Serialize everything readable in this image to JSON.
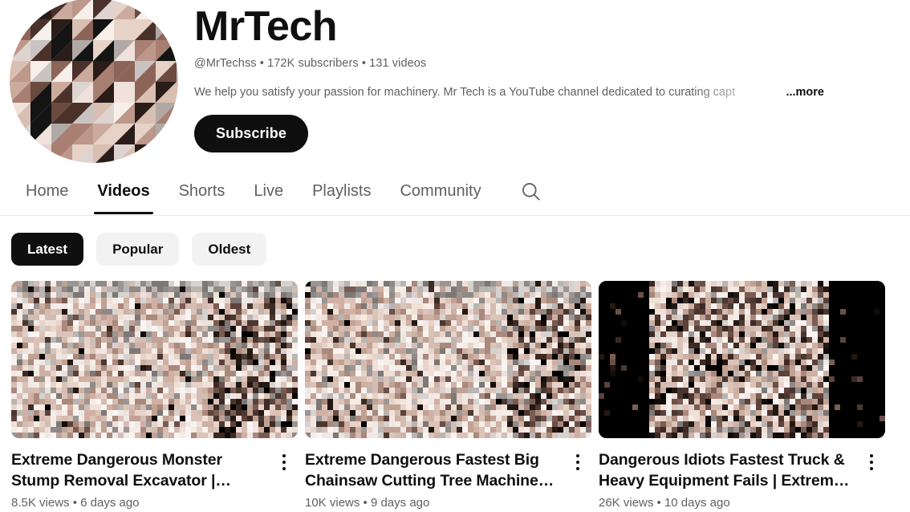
{
  "channel": {
    "name": "MrTech",
    "handle": "@MrTechss",
    "subscribers": "172K subscribers",
    "video_count": "131 videos",
    "meta_line": "@MrTechss • 172K subscribers • 131 videos",
    "description": "We help you satisfy your passion for machinery. Mr Tech is a YouTube channel dedicated to curating capt",
    "more_label": "...more",
    "subscribe_label": "Subscribe",
    "avatar_icon": "mosaic-avatar"
  },
  "tabs": {
    "items": [
      {
        "label": "Home",
        "active": false
      },
      {
        "label": "Videos",
        "active": true
      },
      {
        "label": "Shorts",
        "active": false
      },
      {
        "label": "Live",
        "active": false
      },
      {
        "label": "Playlists",
        "active": false
      },
      {
        "label": "Community",
        "active": false
      }
    ],
    "search_icon": "search-icon"
  },
  "filters": {
    "chips": [
      {
        "label": "Latest",
        "selected": true
      },
      {
        "label": "Popular",
        "selected": false
      },
      {
        "label": "Oldest",
        "selected": false
      }
    ]
  },
  "videos": [
    {
      "title": "Extreme Dangerous Monster Stump Removal Excavator | Fastest Stump...",
      "views": "8.5K views",
      "age": "6 days ago",
      "meta": "8.5K views • 6 days ago",
      "thumbnail_style": "pixelated-beige",
      "menu_icon": "more-vertical-icon"
    },
    {
      "title": "Extreme Dangerous Fastest Big Chainsaw Cutting Tree Machines |...",
      "views": "10K views",
      "age": "9 days ago",
      "meta": "10K views • 9 days ago",
      "thumbnail_style": "pixelated-beige",
      "menu_icon": "more-vertical-icon"
    },
    {
      "title": "Dangerous Idiots Fastest Truck & Heavy Equipment Fails | Extreme Truc...",
      "views": "26K views",
      "age": "10 days ago",
      "meta": "26K views • 10 days ago",
      "thumbnail_style": "pixelated-dark-pillarbox",
      "menu_icon": "more-vertical-icon"
    }
  ],
  "colors": {
    "text_primary": "#0f0f0f",
    "text_secondary": "#606060",
    "chip_bg": "#f2f2f2",
    "chip_selected_bg": "#0f0f0f",
    "divider": "#e8e8e8",
    "page_bg": "#ffffff"
  }
}
